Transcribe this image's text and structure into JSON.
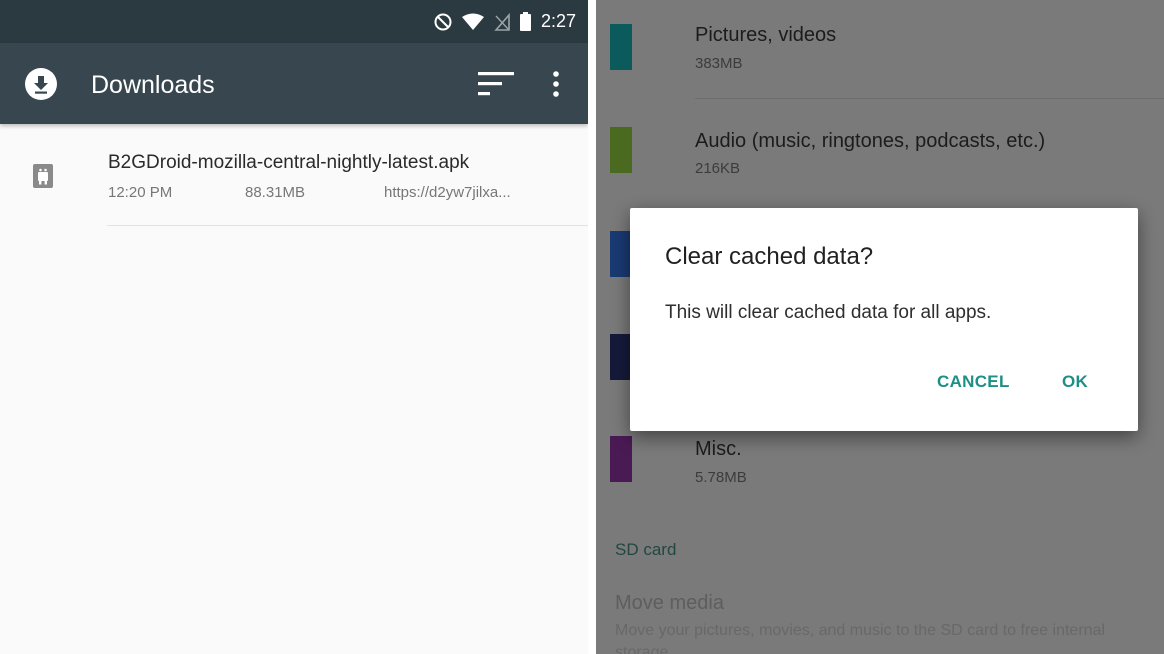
{
  "status_bar": {
    "time": "2:27",
    "icons": [
      "do-not-disturb-icon",
      "wifi-icon",
      "no-sim-icon",
      "battery-icon"
    ]
  },
  "downloads": {
    "title": "Downloads",
    "header_icon": "download-circle-icon",
    "actions": [
      "sort-icon",
      "overflow-menu-icon"
    ],
    "items": [
      {
        "icon": "apk-file-icon",
        "filename": "B2GDroid-mozilla-central-nightly-latest.apk",
        "time": "12:20 PM",
        "size": "88.31MB",
        "source": "https://d2yw7jilxa..."
      }
    ]
  },
  "storage": {
    "categories": [
      {
        "name": "Pictures, videos",
        "size": "383MB",
        "color": "#0b5b5c"
      },
      {
        "name": "Audio (music, ringtones, podcasts, etc.)",
        "size": "216KB",
        "color": "#4a6a20"
      },
      {
        "name": "",
        "size": "",
        "color": "#1a3a73"
      },
      {
        "name": "",
        "size": "",
        "color": "#151a3a"
      },
      {
        "name": "Misc.",
        "size": "5.78MB",
        "color": "#4a1a55"
      }
    ],
    "section_sd": "SD card",
    "move_media_title": "Move media",
    "move_media_desc": "Move your pictures, movies, and music to the SD card to free internal storage"
  },
  "dialog": {
    "title": "Clear cached data?",
    "message": "This will clear cached data for all apps.",
    "cancel": "CANCEL",
    "ok": "OK"
  }
}
